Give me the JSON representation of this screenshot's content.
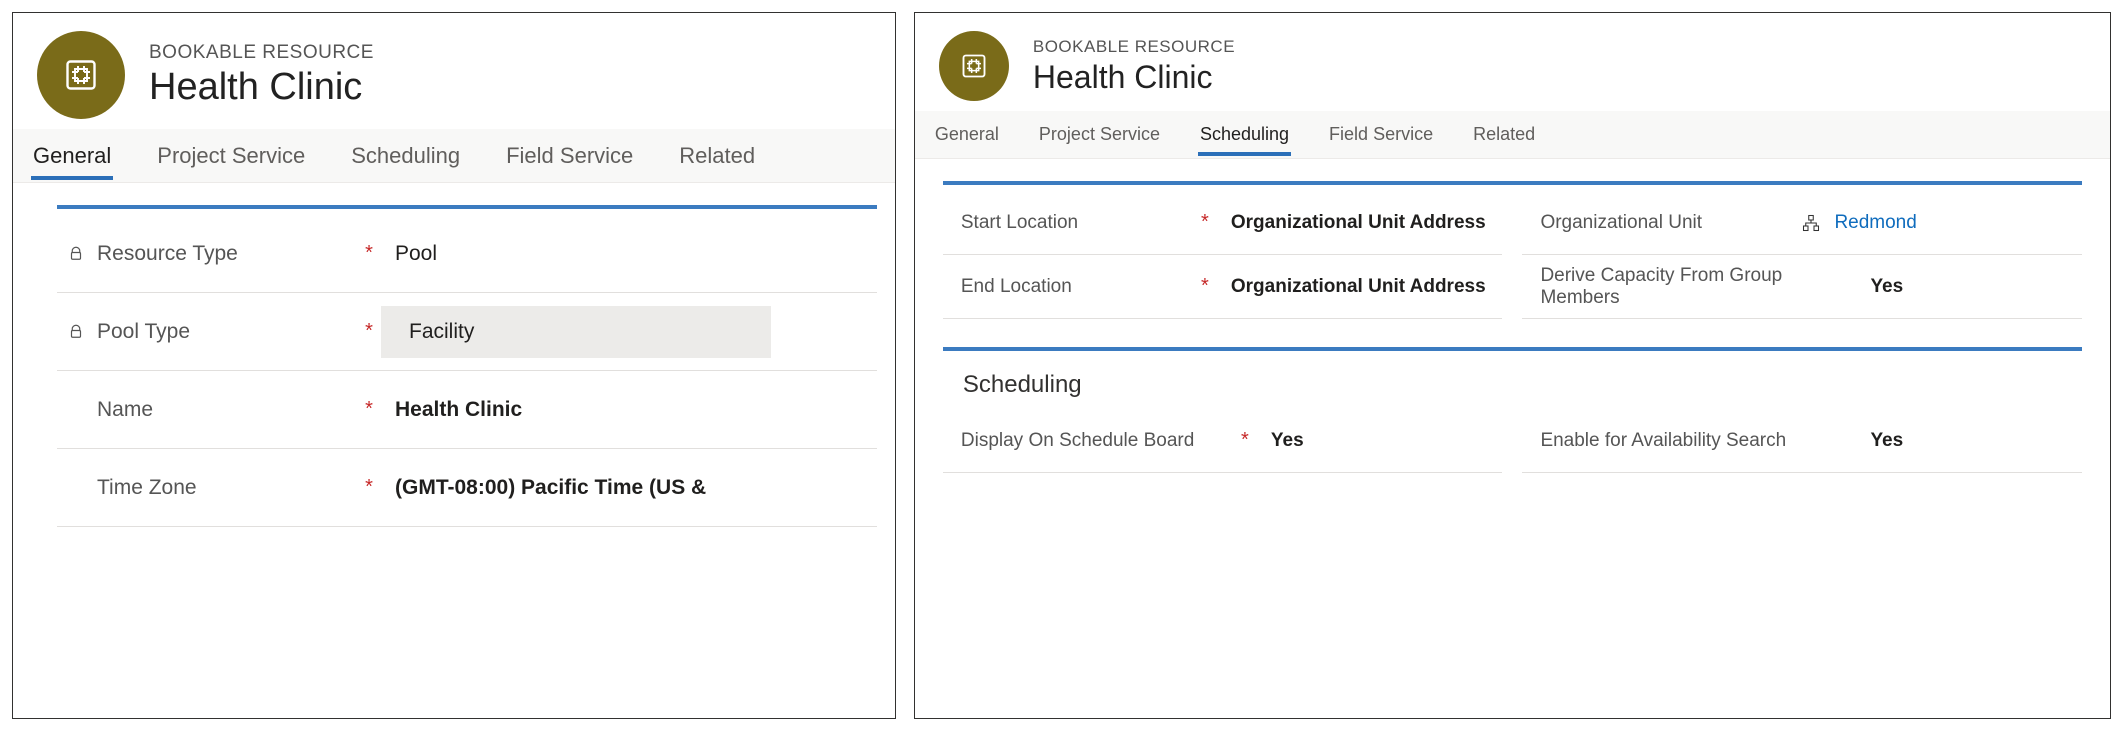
{
  "entity": {
    "subtitle": "BOOKABLE RESOURCE",
    "title": "Health Clinic"
  },
  "left": {
    "tabs": [
      {
        "label": "General",
        "active": true
      },
      {
        "label": "Project Service",
        "active": false
      },
      {
        "label": "Scheduling",
        "active": false
      },
      {
        "label": "Field Service",
        "active": false
      },
      {
        "label": "Related",
        "active": false
      }
    ],
    "fields": {
      "resource_type": {
        "label": "Resource Type",
        "value": "Pool",
        "locked": true,
        "required": true
      },
      "pool_type": {
        "label": "Pool Type",
        "value": "Facility",
        "locked": true,
        "required": true
      },
      "name": {
        "label": "Name",
        "value": "Health Clinic",
        "locked": false,
        "required": true
      },
      "time_zone": {
        "label": "Time Zone",
        "value": "(GMT-08:00) Pacific Time (US &",
        "locked": false,
        "required": true
      }
    }
  },
  "right": {
    "tabs": [
      {
        "label": "General",
        "active": false
      },
      {
        "label": "Project Service",
        "active": false
      },
      {
        "label": "Scheduling",
        "active": true
      },
      {
        "label": "Field Service",
        "active": false
      },
      {
        "label": "Related",
        "active": false
      }
    ],
    "location": {
      "start_location": {
        "label": "Start Location",
        "value": "Organizational Unit Address",
        "required": true
      },
      "end_location": {
        "label": "End Location",
        "value": "Organizational Unit Address",
        "required": true
      },
      "org_unit": {
        "label": "Organizational Unit",
        "value": "Redmond"
      },
      "derive_capacity": {
        "label": "Derive Capacity From Group Members",
        "value": "Yes"
      }
    },
    "scheduling": {
      "section_title": "Scheduling",
      "display_on_board": {
        "label": "Display On Schedule Board",
        "value": "Yes",
        "required": true
      },
      "enable_search": {
        "label": "Enable for Availability Search",
        "value": "Yes"
      }
    }
  }
}
